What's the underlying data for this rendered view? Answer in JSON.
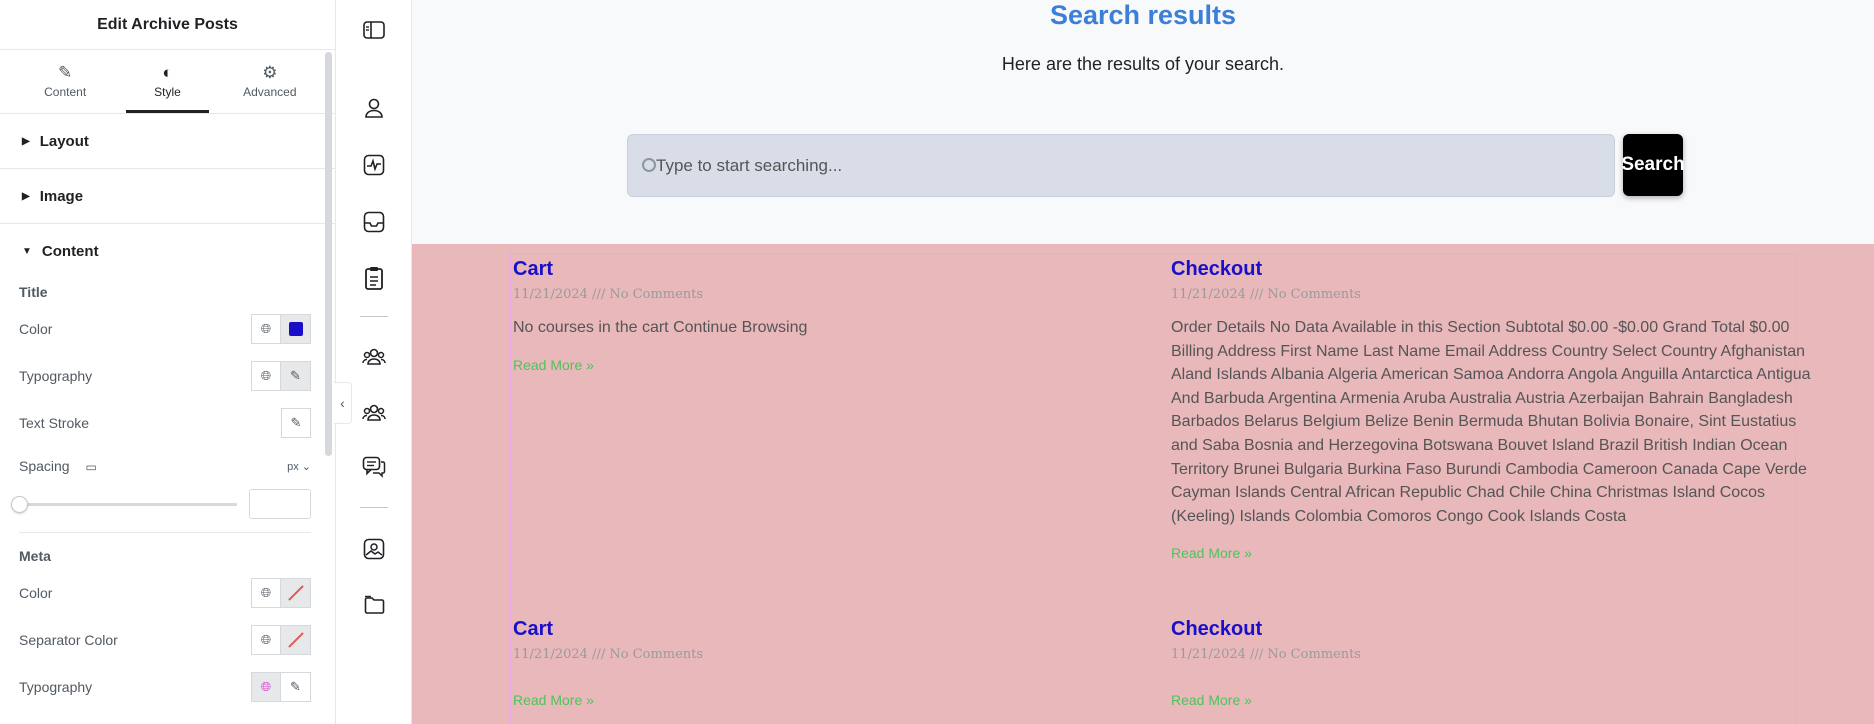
{
  "panel": {
    "title": "Edit Archive Posts",
    "tabs": [
      {
        "label": "Content",
        "icon": "pencil-icon"
      },
      {
        "label": "Style",
        "icon": "half-circle-icon"
      },
      {
        "label": "Advanced",
        "icon": "gear-icon"
      }
    ],
    "sections": {
      "layout": "Layout",
      "image": "Image",
      "content": "Content"
    },
    "title_group": {
      "label": "Title",
      "color_label": "Color",
      "color_value": "#1a0fc9",
      "typography_label": "Typography",
      "text_stroke_label": "Text Stroke",
      "spacing_label": "Spacing",
      "spacing_unit": "px"
    },
    "meta_group": {
      "label": "Meta",
      "color_label": "Color",
      "separator_color_label": "Separator Color",
      "typography_label": "Typography"
    }
  },
  "canvas": {
    "title": "Search results",
    "subtitle": "Here are the results of your search.",
    "search": {
      "placeholder": "Type to start searching...",
      "button_label": "Search"
    },
    "posts": [
      {
        "title": "Cart",
        "meta": "11/21/2024 /// No Comments",
        "excerpt": "No courses in the cart Continue Browsing",
        "read_more": "Read More »"
      },
      {
        "title": "Checkout",
        "meta": "11/21/2024 /// No Comments",
        "excerpt": "Order Details No Data Available in this Section Subtotal $0.00 -$0.00 Grand Total $0.00 Billing Address First Name Last Name Email Address Country Select Country Afghanistan Aland Islands Albania Algeria American Samoa Andorra Angola Anguilla Antarctica Antigua And Barbuda Argentina Armenia Aruba Australia Austria Azerbaijan Bahrain Bangladesh Barbados Belarus Belgium Belize Benin Bermuda Bhutan Bolivia Bonaire, Sint Eustatius and Saba Bosnia and Herzegovina Botswana Bouvet Island Brazil British Indian Ocean Territory Brunei Bulgaria Burkina Faso Burundi Cambodia Cameroon Canada Cape Verde Cayman Islands Central African Republic Chad Chile China Christmas Island Cocos (Keeling) Islands Colombia Comoros Congo Cook Islands Costa",
        "read_more": "Read More »"
      },
      {
        "title": "Cart",
        "meta": "11/21/2024 /// No Comments",
        "excerpt": "",
        "read_more": "Read More »"
      },
      {
        "title": "Checkout",
        "meta": "11/21/2024 /// No Comments",
        "excerpt": "",
        "read_more": "Read More »"
      }
    ]
  },
  "colors": {
    "title_blue": "#3b7fd9",
    "post_title": "#1a0fc9",
    "read_more_green": "#4cc45a",
    "posts_background": "#e8b8bb"
  }
}
